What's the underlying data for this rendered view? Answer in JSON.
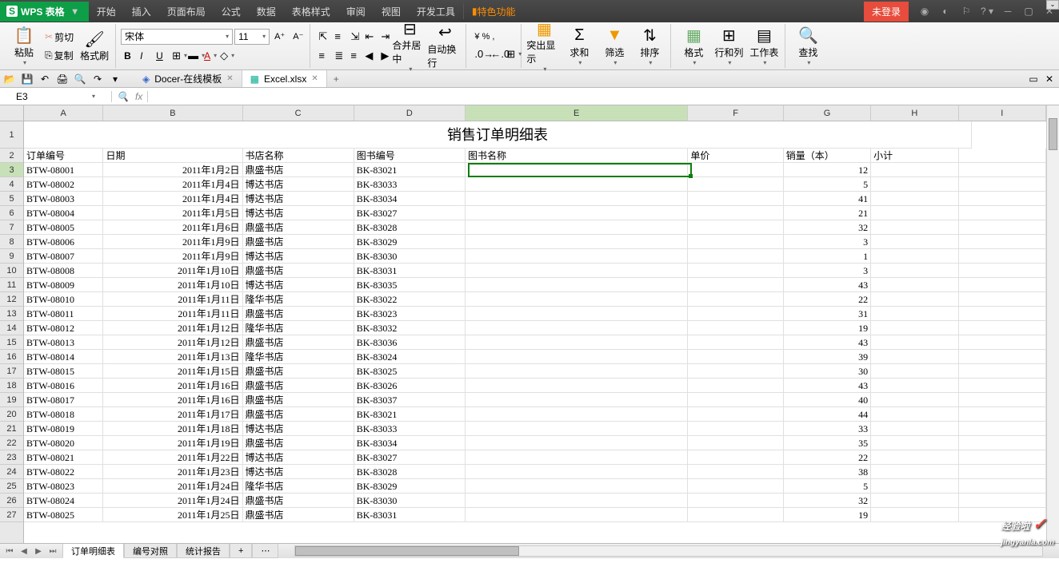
{
  "app": {
    "name": "WPS 表格",
    "logo": "S"
  },
  "menu": [
    "开始",
    "插入",
    "页面布局",
    "公式",
    "数据",
    "表格样式",
    "审阅",
    "视图",
    "开发工具"
  ],
  "menu_special": "特色功能",
  "login": "未登录",
  "ribbon": {
    "paste": "粘贴",
    "cut": "剪切",
    "copy": "复制",
    "format_painter": "格式刷",
    "font_name": "宋体",
    "font_size": "11",
    "merge_center": "合并居中",
    "wrap": "自动换行",
    "highlight": "突出显示",
    "sum": "求和",
    "filter": "筛选",
    "sort": "排序",
    "format": "格式",
    "rowcol": "行和列",
    "worksheet": "工作表",
    "find": "查找"
  },
  "tabs": [
    {
      "icon": "📘",
      "label": "Docer-在线模板"
    },
    {
      "icon": "📗",
      "label": "Excel.xlsx"
    }
  ],
  "name_box": "E3",
  "title_cell": "销售订单明细表",
  "headers": [
    "订单编号",
    "日期",
    "书店名称",
    "图书编号",
    "图书名称",
    "单价",
    "销量（本）",
    "小计"
  ],
  "cols": [
    "A",
    "B",
    "C",
    "D",
    "E",
    "F",
    "G",
    "H",
    "I"
  ],
  "rows": [
    {
      "n": 3,
      "a": "BTW-08001",
      "b": "2011年1月2日",
      "c": "鼎盛书店",
      "d": "BK-83021",
      "g": "12"
    },
    {
      "n": 4,
      "a": "BTW-08002",
      "b": "2011年1月4日",
      "c": "博达书店",
      "d": "BK-83033",
      "g": "5"
    },
    {
      "n": 5,
      "a": "BTW-08003",
      "b": "2011年1月4日",
      "c": "博达书店",
      "d": "BK-83034",
      "g": "41"
    },
    {
      "n": 6,
      "a": "BTW-08004",
      "b": "2011年1月5日",
      "c": "博达书店",
      "d": "BK-83027",
      "g": "21"
    },
    {
      "n": 7,
      "a": "BTW-08005",
      "b": "2011年1月6日",
      "c": "鼎盛书店",
      "d": "BK-83028",
      "g": "32"
    },
    {
      "n": 8,
      "a": "BTW-08006",
      "b": "2011年1月9日",
      "c": "鼎盛书店",
      "d": "BK-83029",
      "g": "3"
    },
    {
      "n": 9,
      "a": "BTW-08007",
      "b": "2011年1月9日",
      "c": "博达书店",
      "d": "BK-83030",
      "g": "1"
    },
    {
      "n": 10,
      "a": "BTW-08008",
      "b": "2011年1月10日",
      "c": "鼎盛书店",
      "d": "BK-83031",
      "g": "3"
    },
    {
      "n": 11,
      "a": "BTW-08009",
      "b": "2011年1月10日",
      "c": "博达书店",
      "d": "BK-83035",
      "g": "43"
    },
    {
      "n": 12,
      "a": "BTW-08010",
      "b": "2011年1月11日",
      "c": "隆华书店",
      "d": "BK-83022",
      "g": "22"
    },
    {
      "n": 13,
      "a": "BTW-08011",
      "b": "2011年1月11日",
      "c": "鼎盛书店",
      "d": "BK-83023",
      "g": "31"
    },
    {
      "n": 14,
      "a": "BTW-08012",
      "b": "2011年1月12日",
      "c": "隆华书店",
      "d": "BK-83032",
      "g": "19"
    },
    {
      "n": 15,
      "a": "BTW-08013",
      "b": "2011年1月12日",
      "c": "鼎盛书店",
      "d": "BK-83036",
      "g": "43"
    },
    {
      "n": 16,
      "a": "BTW-08014",
      "b": "2011年1月13日",
      "c": "隆华书店",
      "d": "BK-83024",
      "g": "39"
    },
    {
      "n": 17,
      "a": "BTW-08015",
      "b": "2011年1月15日",
      "c": "鼎盛书店",
      "d": "BK-83025",
      "g": "30"
    },
    {
      "n": 18,
      "a": "BTW-08016",
      "b": "2011年1月16日",
      "c": "鼎盛书店",
      "d": "BK-83026",
      "g": "43"
    },
    {
      "n": 19,
      "a": "BTW-08017",
      "b": "2011年1月16日",
      "c": "鼎盛书店",
      "d": "BK-83037",
      "g": "40"
    },
    {
      "n": 20,
      "a": "BTW-08018",
      "b": "2011年1月17日",
      "c": "鼎盛书店",
      "d": "BK-83021",
      "g": "44"
    },
    {
      "n": 21,
      "a": "BTW-08019",
      "b": "2011年1月18日",
      "c": "博达书店",
      "d": "BK-83033",
      "g": "33"
    },
    {
      "n": 22,
      "a": "BTW-08020",
      "b": "2011年1月19日",
      "c": "鼎盛书店",
      "d": "BK-83034",
      "g": "35"
    },
    {
      "n": 23,
      "a": "BTW-08021",
      "b": "2011年1月22日",
      "c": "博达书店",
      "d": "BK-83027",
      "g": "22"
    },
    {
      "n": 24,
      "a": "BTW-08022",
      "b": "2011年1月23日",
      "c": "博达书店",
      "d": "BK-83028",
      "g": "38"
    },
    {
      "n": 25,
      "a": "BTW-08023",
      "b": "2011年1月24日",
      "c": "隆华书店",
      "d": "BK-83029",
      "g": "5"
    },
    {
      "n": 26,
      "a": "BTW-08024",
      "b": "2011年1月24日",
      "c": "鼎盛书店",
      "d": "BK-83030",
      "g": "32"
    },
    {
      "n": 27,
      "a": "BTW-08025",
      "b": "2011年1月25日",
      "c": "鼎盛书店",
      "d": "BK-83031",
      "g": "19"
    }
  ],
  "sheets": [
    "订单明细表",
    "编号对照",
    "统计报告"
  ],
  "watermark": {
    "text": "经验啦",
    "sub": "jingyanla.com"
  }
}
